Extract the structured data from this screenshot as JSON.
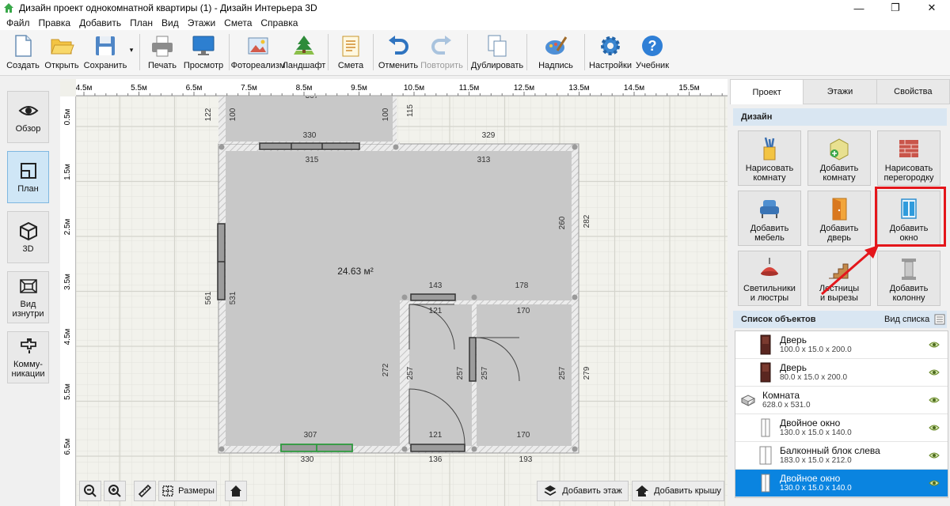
{
  "window": {
    "title": "Дизайн проект однокомнатной квартиры (1) - Дизайн Интерьера 3D",
    "minimize": "—",
    "maximize": "❐",
    "close": "✕"
  },
  "menu": [
    "Файл",
    "Правка",
    "Добавить",
    "План",
    "Вид",
    "Этажи",
    "Смета",
    "Справка"
  ],
  "toolbar": {
    "create": "Создать",
    "open": "Открыть",
    "save": "Сохранить",
    "save_arrow": "▾",
    "print": "Печать",
    "preview": "Просмотр",
    "photorealism": "Фотореализм",
    "landscape": "Ландшафт",
    "estimate": "Смета",
    "undo": "Отменить",
    "redo": "Повторить",
    "duplicate": "Дублировать",
    "caption": "Надпись",
    "settings": "Настройки",
    "tutorial": "Учебник"
  },
  "left_panel": {
    "overview": "Обзор",
    "plan": "План",
    "view3d": "3D",
    "inside_1": "Вид",
    "inside_2": "изнутри",
    "comm_1": "Комму-",
    "comm_2": "никации"
  },
  "rulers": {
    "top": [
      "4.5м",
      "5.5м",
      "6.5м",
      "7.5м",
      "8.5м",
      "9.5м",
      "10.5м",
      "11.5м",
      "12.5м",
      "13.5м",
      "14.5м",
      "15.5м"
    ],
    "left": [
      "0.5м",
      "1.5м",
      "2.5м",
      "3.5м",
      "4.5м",
      "5.5м",
      "6.5м"
    ]
  },
  "plan": {
    "area": "24.63 м²",
    "dims": {
      "d122": "122",
      "d100a": "100",
      "d100b": "100",
      "d115": "115",
      "d307top": "307",
      "d330top": "330",
      "d329": "329",
      "d315": "315",
      "d313": "313",
      "d260": "260",
      "d282": "282",
      "d561": "561",
      "d531": "531",
      "d143": "143",
      "d178": "178",
      "d121a": "121",
      "d170a": "170",
      "d272": "272",
      "d257a": "257",
      "d257b": "257",
      "d257c": "257",
      "d257d": "257",
      "d279": "279",
      "d307": "307",
      "d121b": "121",
      "d170b": "170",
      "d330": "330",
      "d136": "136",
      "d193": "193"
    }
  },
  "canvas_tools": {
    "sizes": "Размеры",
    "add_floor": "Добавить этаж",
    "add_roof": "Добавить крышу"
  },
  "right_panel": {
    "tabs": [
      "Проект",
      "Этажи",
      "Свойства"
    ],
    "design_header": "Дизайн",
    "buttons": {
      "draw_room_1": "Нарисовать",
      "draw_room_2": "комнату",
      "add_room_1": "Добавить",
      "add_room_2": "комнату",
      "draw_wall_1": "Нарисовать",
      "draw_wall_2": "перегородку",
      "add_furniture_1": "Добавить",
      "add_furniture_2": "мебель",
      "add_door_1": "Добавить",
      "add_door_2": "дверь",
      "add_window_1": "Добавить",
      "add_window_2": "окно",
      "lights_1": "Светильники",
      "lights_2": "и люстры",
      "stairs_1": "Лестницы",
      "stairs_2": "и вырезы",
      "column_1": "Добавить",
      "column_2": "колонну"
    },
    "objects_header": "Список объектов",
    "view_list": "Вид списка",
    "objects": [
      {
        "name": "Дверь",
        "dims": "100.0 x 15.0 x 200.0"
      },
      {
        "name": "Дверь",
        "dims": "80.0 x 15.0 x 200.0"
      },
      {
        "name": "Комната",
        "dims": "628.0 x 531.0"
      },
      {
        "name": "Двойное окно",
        "dims": "130.0 x 15.0 x 140.0"
      },
      {
        "name": "Балконный блок слева",
        "dims": "183.0 x 15.0 x 212.0"
      },
      {
        "name": "Двойное окно",
        "dims": "130.0 x 15.0 x 140.0"
      }
    ]
  },
  "colors": {
    "accent": "#0a84e0",
    "highlight": "#e4161b",
    "section": "#d9e6f2",
    "floor": "#c8c8c8",
    "wall": "#ececec"
  }
}
